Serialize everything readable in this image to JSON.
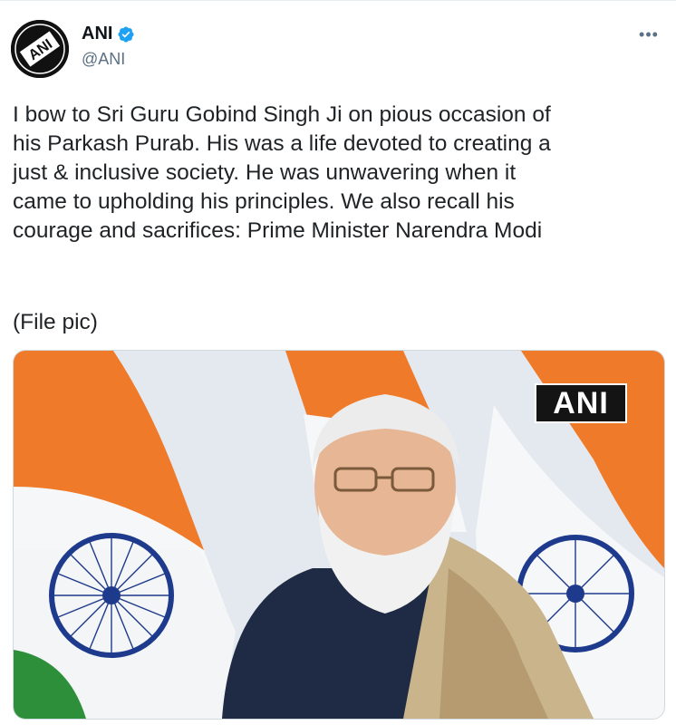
{
  "account": {
    "display_name": "ANI",
    "handle": "@ANI",
    "avatar_icon": "ani-logo-icon",
    "verified_icon": "verified-badge-icon",
    "verified_color": "#1da1f2"
  },
  "menu": {
    "more_icon": "more-options-icon",
    "glyph": "•••"
  },
  "tweet": {
    "text": "I bow to Sri Guru Gobind Singh Ji on pious occasion of\nhis Parkash Purab. His was a life devoted to creating a\njust & inclusive society. He was unwavering when it\ncame to upholding his principles. We also recall his\ncourage and sacrifices: Prime Minister Narendra Modi",
    "caption": "(File pic)"
  },
  "media": {
    "watermark": "ANI",
    "flag_colors": {
      "saffron": "#ef7a2a",
      "white": "#f6f7f8",
      "green": "#2e8f3b",
      "chakra": "#1e3a8c"
    }
  }
}
